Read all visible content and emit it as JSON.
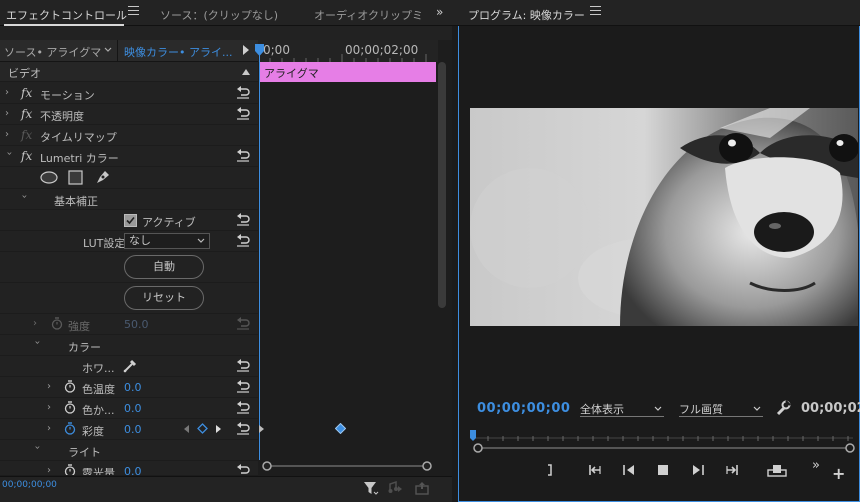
{
  "tabs": {
    "effect_controls": "エフェクトコントロール",
    "source": "ソース：(クリップなし)",
    "audio_clip_mixer": "オーディオクリップミ",
    "program": "プログラム: 映像カラー"
  },
  "effect_controls": {
    "source_label": "ソース• アライグマ",
    "sequence_label": "映像カラー• アライ...",
    "section_video": "ビデオ",
    "rows": {
      "motion": "モーション",
      "opacity": "不透明度",
      "time_remap": "タイムリマップ",
      "lumetri": "Lumetri カラー",
      "basic_correction": "基本補正",
      "active": "アクティブ",
      "lut_label": "LUT設定",
      "lut_value": "なし",
      "auto_button": "自動",
      "reset_button": "リセット",
      "intensity": "強度",
      "intensity_value": "50.0",
      "color": "カラー",
      "white_balance": "ホワ...",
      "temperature": "色温度",
      "temperature_value": "0.0",
      "tint": "色か...",
      "tint_value": "0.0",
      "saturation": "彩度",
      "saturation_value": "0.0",
      "light": "ライト",
      "exposure": "露光量",
      "exposure_value": "0.0"
    },
    "timeline": {
      "ruler_start": "0;00",
      "ruler_mark": "00;00;02;00",
      "clip_name": "アライグマ"
    },
    "footer_timecode": "00;00;00;00"
  },
  "program": {
    "current_timecode": "00;00;00;00",
    "zoom_select": "全体表示",
    "quality_select": "フル画質",
    "duration_timecode": "00;00;02"
  },
  "colors": {
    "accent": "#3d8ee0",
    "clip": "#e67ee6"
  }
}
